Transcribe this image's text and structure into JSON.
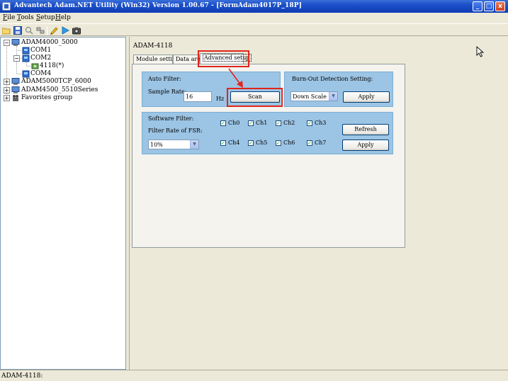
{
  "window": {
    "title": "Advantech Adam.NET Utility (Win32) Version 1.00.67 - [FormAdam4017P_18P]",
    "min_symbol": "_",
    "max_symbol": "□",
    "close_symbol": "x"
  },
  "menu": {
    "file": {
      "hotkey": "F",
      "rest": "ile"
    },
    "tools": {
      "hotkey": "T",
      "rest": "ools"
    },
    "setup": {
      "hotkey": "S",
      "rest": "etup"
    },
    "help": {
      "hotkey": "H",
      "rest": "elp"
    }
  },
  "toolbar": {
    "icons": [
      "open-folder-icon",
      "save-icon",
      "search-icon",
      "network-scan-icon",
      "pencil-icon",
      "run-icon",
      "camera-icon"
    ]
  },
  "tree": {
    "expand_minus": "−",
    "expand_plus": "+",
    "adam4000": "ADAM4000_5000",
    "com1": "COM1",
    "com2": "COM2",
    "module4118": "4118(*)",
    "com4": "COM4",
    "adam5000tcp": "ADAM5000TCP_6000",
    "adam4500": "ADAM4500_5510Series",
    "favorites": "Favorites group"
  },
  "main": {
    "module_title": "ADAM-4118",
    "tabs": {
      "module_setting": "Module setting",
      "data_area": "Data area",
      "advanced_setup": "Advanced setup"
    },
    "auto_filter": {
      "title": "Auto Filter:",
      "sample_rate_label": "Sample Rate:",
      "sample_rate_value": "16",
      "unit": "Hz",
      "scan_button": "Scan"
    },
    "burn_out": {
      "title": "Burn-Out Detection Setting:",
      "selected": "Down Scale",
      "apply_button": "Apply"
    },
    "software_filter": {
      "title": "Software Filter:",
      "rate_label": "Filter Rate of FSR:",
      "rate_selected": "10%",
      "channels": [
        "Ch0",
        "Ch1",
        "Ch2",
        "Ch3",
        "Ch4",
        "Ch5",
        "Ch6",
        "Ch7"
      ],
      "checked_mark": "✓",
      "refresh_button": "Refresh",
      "apply_button": "Apply"
    }
  },
  "status": {
    "text": "ADAM-4118:"
  },
  "colors": {
    "titlebar": "#1b4fc9",
    "group_bg": "#9cc4e4",
    "highlight": "#e2231a"
  }
}
